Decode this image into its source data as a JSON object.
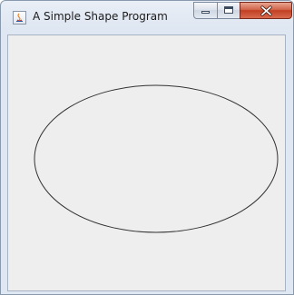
{
  "window": {
    "title": "A Simple Shape Program"
  },
  "icons": {
    "app": "java-app-icon",
    "minimize": "minimize-icon",
    "maximize": "maximize-icon",
    "close": "close-icon"
  },
  "colors": {
    "titlebar": "#dfe7f2",
    "client_background": "#eeeeee",
    "shape_stroke": "#333333",
    "close_button": "#c94a2f"
  },
  "canvas": {
    "shape": "ellipse"
  }
}
